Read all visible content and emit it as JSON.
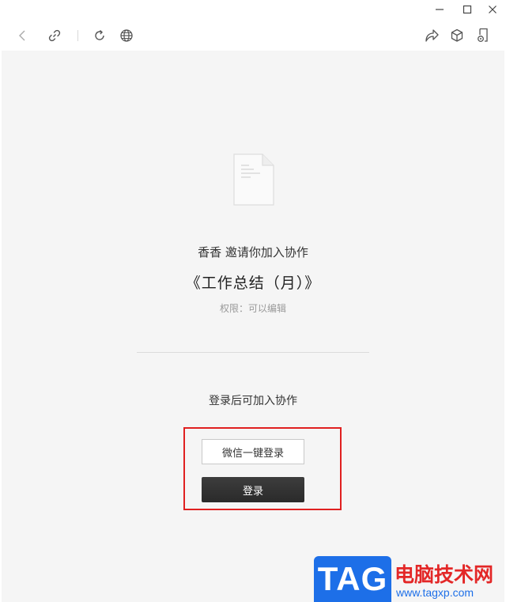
{
  "window": {
    "controls": [
      "minimize-icon",
      "maximize-icon",
      "close-icon"
    ]
  },
  "toolbar": {
    "left_icons": [
      "back-arrow-icon",
      "link-icon",
      "refresh-icon",
      "globe-icon"
    ],
    "right_icons": [
      "share-icon",
      "cube-icon",
      "document-settings-icon"
    ]
  },
  "invite": {
    "inviter_line": "香香 邀请你加入协作",
    "document_title": "《工作总结（月）》",
    "permission": "权限：可以编辑"
  },
  "login": {
    "hint": "登录后可加入协作",
    "wechat_button": "微信一键登录",
    "login_button": "登录"
  },
  "annotation": {
    "highlight_color": "#e02020"
  },
  "watermark": {
    "tag": "TAG",
    "site_name": "电脑技术网",
    "url": "www.tagxp.com"
  },
  "colors": {
    "content_bg": "#f5f5f5",
    "login_button_bg": "#333333",
    "watermark_blue": "#1d6fe8",
    "watermark_red": "#e32727"
  }
}
